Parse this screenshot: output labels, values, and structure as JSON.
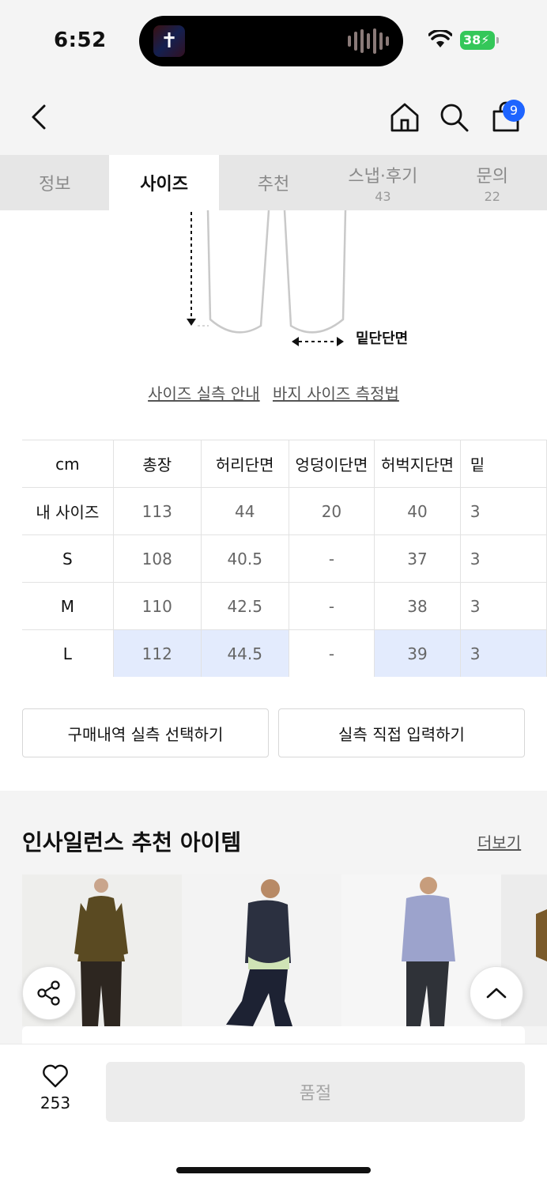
{
  "status": {
    "time": "6:52",
    "battery": "38"
  },
  "header": {
    "cart_count": "9"
  },
  "tabs": [
    {
      "label": "정보",
      "count": ""
    },
    {
      "label": "사이즈",
      "count": ""
    },
    {
      "label": "추천",
      "count": ""
    },
    {
      "label": "스냅·후기",
      "count": "43"
    },
    {
      "label": "문의",
      "count": "22"
    }
  ],
  "diagram": {
    "hem_label": "밑단단면"
  },
  "links": {
    "size_guide": "사이즈 실측 안내",
    "pants_measure": "바지 사이즈 측정법"
  },
  "size_table": {
    "headers": [
      "cm",
      "총장",
      "허리단면",
      "엉덩이단면",
      "허벅지단면",
      "밑"
    ],
    "rows": [
      {
        "label": "내 사이즈",
        "values": [
          "113",
          "44",
          "20",
          "40",
          "3"
        ]
      },
      {
        "label": "S",
        "values": [
          "108",
          "40.5",
          "-",
          "37",
          "3"
        ]
      },
      {
        "label": "M",
        "values": [
          "110",
          "42.5",
          "-",
          "38",
          "3"
        ]
      },
      {
        "label": "L",
        "values": [
          "112",
          "44.5",
          "-",
          "39",
          "3"
        ]
      }
    ]
  },
  "buttons": {
    "purchase_history": "구매내역 실측 선택하기",
    "manual_input": "실측 직접 입력하기"
  },
  "recommend": {
    "title": "인사일런스 추천 아이템",
    "more": "더보기"
  },
  "bottom": {
    "likes": "253",
    "soldout": "품절"
  },
  "colors": {
    "accent": "#1e64ff",
    "highlight": "#e3ebfd",
    "battery": "#34c759"
  }
}
